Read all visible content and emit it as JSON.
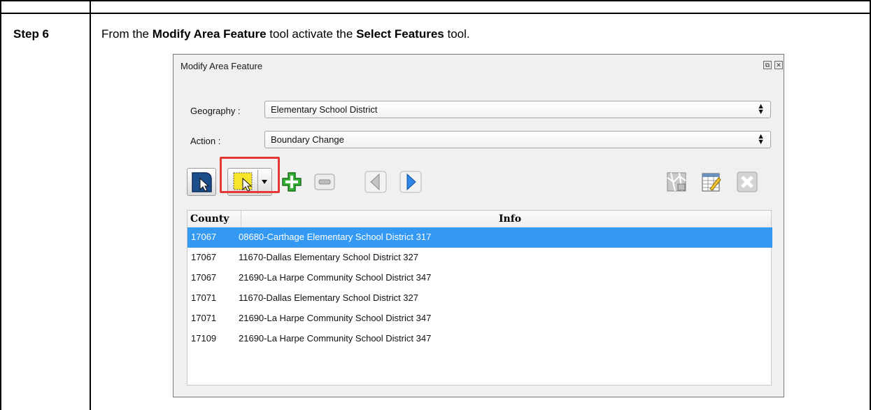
{
  "document": {
    "step_label": "Step 6",
    "instruction": {
      "part1": "From the ",
      "bold1": "Modify Area Feature",
      "part2": " tool activate the ",
      "bold2": "Select Features",
      "part3": " tool."
    }
  },
  "dialog": {
    "title": "Modify Area Feature",
    "geography_label": "Geography :",
    "geography_value": "Elementary School District",
    "action_label": "Action :",
    "action_value": "Boundary Change",
    "toolbar": {
      "icons": [
        "select-area-icon",
        "select-features-icon",
        "dropdown-arrow-icon",
        "add-icon",
        "remove-icon",
        "previous-icon",
        "next-icon",
        "map-icon",
        "edit-table-icon",
        "close-icon"
      ]
    },
    "table": {
      "columns": [
        "County",
        "Info"
      ],
      "rows": [
        {
          "county": "17067",
          "info": "08680-Carthage Elementary School District 317",
          "selected": true
        },
        {
          "county": "17067",
          "info": "11670-Dallas Elementary School District 327",
          "selected": false
        },
        {
          "county": "17067",
          "info": "21690-La Harpe Community School District 347",
          "selected": false
        },
        {
          "county": "17071",
          "info": "11670-Dallas Elementary School District 327",
          "selected": false
        },
        {
          "county": "17071",
          "info": "21690-La Harpe Community School District 347",
          "selected": false
        },
        {
          "county": "17109",
          "info": "21690-La Harpe Community School District 347",
          "selected": false
        }
      ]
    }
  },
  "colors": {
    "highlight": "#e53935",
    "selected_row": "#3399f3",
    "add_green": "#2e9e2e",
    "nav_blue": "#1f6fd1"
  }
}
